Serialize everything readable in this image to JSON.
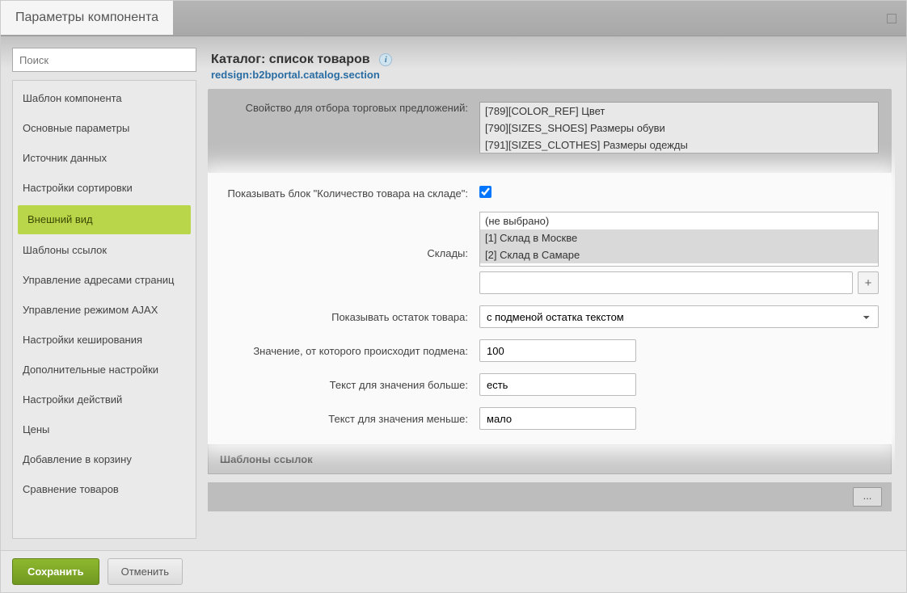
{
  "window": {
    "title": "Параметры компонента"
  },
  "search": {
    "placeholder": "Поиск"
  },
  "sidebar": {
    "items": [
      {
        "label": "Шаблон компонента"
      },
      {
        "label": "Основные параметры"
      },
      {
        "label": "Источник данных"
      },
      {
        "label": "Настройки сортировки"
      },
      {
        "label": "Внешний вид",
        "active": true
      },
      {
        "label": "Шаблоны ссылок"
      },
      {
        "label": "Управление адресами страниц"
      },
      {
        "label": "Управление режимом AJAX"
      },
      {
        "label": "Настройки кеширования"
      },
      {
        "label": "Дополнительные настройки"
      },
      {
        "label": "Настройки действий"
      },
      {
        "label": "Цены"
      },
      {
        "label": "Добавление в корзину"
      },
      {
        "label": "Сравнение товаров"
      }
    ]
  },
  "header": {
    "title": "Каталог: список товаров",
    "subtitle": "redsign:b2bportal.catalog.section"
  },
  "form": {
    "offers_prop_label": "Свойство для отбора торговых предложений:",
    "offers_prop_options": [
      "[789][COLOR_REF] Цвет",
      "[790][SIZES_SHOES] Размеры обуви",
      "[791][SIZES_CLOTHES] Размеры одежды"
    ],
    "show_stock_block_label": "Показывать блок \"Количество товара на складе\":",
    "show_stock_block_checked": true,
    "stores_label": "Склады:",
    "stores_options": [
      "(не выбрано)",
      "[1] Склад в Москве",
      "[2] Склад в Самаре"
    ],
    "plus_button": "+",
    "show_remainder_label": "Показывать остаток товара:",
    "show_remainder_value": "с подменой остатка текстом",
    "threshold_label": "Значение, от которого происходит подмена:",
    "threshold_value": "100",
    "text_more_label": "Текст для значения больше:",
    "text_more_value": "есть",
    "text_less_label": "Текст для значения меньше:",
    "text_less_value": "мало",
    "links_section_title": "Шаблоны ссылок"
  },
  "footer": {
    "save": "Сохранить",
    "cancel": "Отменить"
  }
}
